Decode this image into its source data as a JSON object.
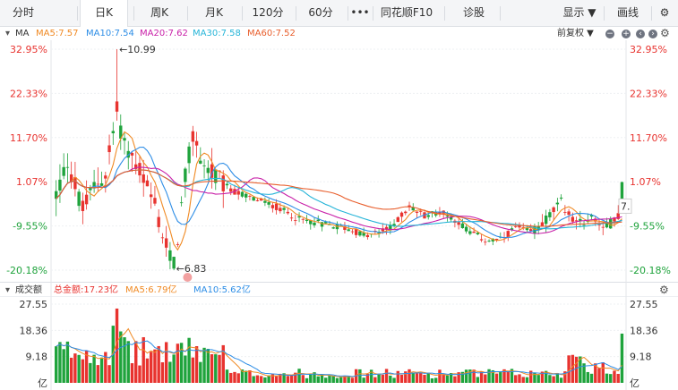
{
  "tabs": {
    "items": [
      "分时",
      "日K",
      "周K",
      "月K",
      "120分",
      "60分",
      "•••",
      "同花顺F10",
      "诊股"
    ],
    "active": "日K",
    "right": [
      "显示 ▼",
      "画线"
    ]
  },
  "main_legend": {
    "label": "MA",
    "ma5": "MA5:7.57",
    "ma10": "MA10:7.54",
    "ma20": "MA20:7.62",
    "ma30": "MA30:7.58",
    "ma60": "MA60:7.52",
    "adjust": "前复权 ▼"
  },
  "volume_legend": {
    "label": "成交额",
    "total": "总金额:17.23亿",
    "ma5": "MA5:6.79亿",
    "ma10": "MA10:5.62亿"
  },
  "colors": {
    "up": "#e8332f",
    "down": "#1fa33c",
    "ma5": "#f08a24",
    "ma10": "#2d8de6",
    "ma20": "#c81fa8",
    "ma30": "#25b4d8",
    "ma60": "#e85e2c"
  },
  "chart_data": {
    "type": "candlestick",
    "price_axis_ticks": [
      "32.95%",
      "22.33%",
      "11.70%",
      "1.07%",
      "-9.55%",
      "-20.18%"
    ],
    "price_ticks_pct": [
      32.95,
      22.33,
      11.7,
      1.07,
      -9.55,
      -20.18
    ],
    "volume_axis_ticks": [
      "27.55",
      "18.36",
      "9.18",
      "亿"
    ],
    "volume_ticks": [
      27.55,
      18.36,
      9.18
    ],
    "annotations": {
      "high": "←10.99",
      "low": "←6.83",
      "last_price": "7."
    },
    "ylim_pct": [
      -20.18,
      32.95
    ],
    "vol_ylim": [
      0,
      27.55
    ],
    "ma_legend": {
      "MA5": 7.57,
      "MA10": 7.54,
      "MA20": 7.62,
      "MA30": 7.58,
      "MA60": 7.52
    }
  }
}
